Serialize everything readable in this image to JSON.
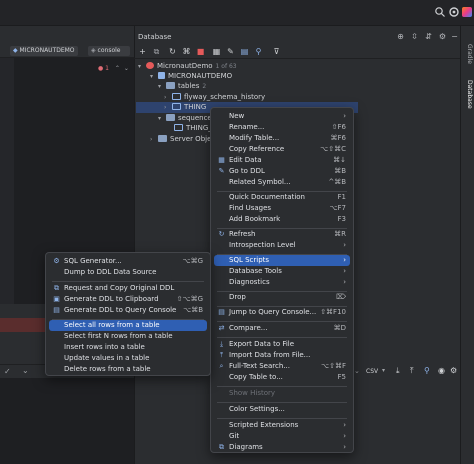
{
  "colors": {
    "accent": "#2f5fb3",
    "selection_row": "#2e436e",
    "error_row": "#5a2d2d",
    "icon_blue": "#8fb3e8",
    "icon_green": "#5fb865",
    "icon_red": "#e55a5a"
  },
  "left_toolbar": {
    "datasource": "MICRONAUTDEMO",
    "console": "console"
  },
  "left_editor": {
    "warning_count": "1"
  },
  "db_panel": {
    "title": "Database"
  },
  "tree": {
    "root": "MicronautDemo",
    "root_badge": "1 of 63",
    "schema": "MICRONAUTDEMO",
    "tables_label": "tables",
    "tables_count": "2",
    "table1": "flyway_schema_history",
    "table2": "THING",
    "sequences": "sequences",
    "sequence_item": "THING_",
    "server_objects": "Server Objects"
  },
  "results_toolbar": {
    "format": "CSV"
  },
  "side_tabs": {
    "gradle": "Gradle",
    "database": "Database"
  },
  "main_menu": {
    "items": [
      {
        "label": "New",
        "shortcut": "",
        "submenu": true
      },
      {
        "label": "Rename...",
        "shortcut": "⇧F6"
      },
      {
        "label": "Modify Table...",
        "shortcut": "⌘F6"
      },
      {
        "label": "Copy Reference",
        "shortcut": "⌥⇧⌘C"
      },
      {
        "label": "Edit Data",
        "shortcut": "⌘↓"
      },
      {
        "label": "Go to DDL",
        "shortcut": "⌘B"
      },
      {
        "label": "Related Symbol...",
        "shortcut": "^⌘B"
      },
      {
        "label": "Quick Documentation",
        "shortcut": "F1"
      },
      {
        "label": "Find Usages",
        "shortcut": "⌥F7"
      },
      {
        "label": "Add Bookmark",
        "shortcut": "F3"
      },
      {
        "label": "Refresh",
        "shortcut": "⌘R"
      },
      {
        "label": "Introspection Level",
        "submenu": true
      },
      {
        "label": "SQL Scripts",
        "submenu": true
      },
      {
        "label": "Database Tools",
        "submenu": true
      },
      {
        "label": "Diagnostics",
        "submenu": true
      },
      {
        "label": "Drop",
        "shortcut": "⌦"
      },
      {
        "label": "Jump to Query Console...",
        "shortcut": "⇧⌘F10"
      },
      {
        "label": "Compare...",
        "shortcut": "⌘D"
      },
      {
        "label": "Export Data to File"
      },
      {
        "label": "Import Data from File..."
      },
      {
        "label": "Full-Text Search...",
        "shortcut": "⌥⇧⌘F"
      },
      {
        "label": "Copy Table to...",
        "shortcut": "F5"
      },
      {
        "label": "Show History"
      },
      {
        "label": "Color Settings..."
      },
      {
        "label": "Scripted Extensions",
        "submenu": true
      },
      {
        "label": "Git",
        "submenu": true
      },
      {
        "label": "Diagrams",
        "submenu": true
      }
    ]
  },
  "sub_menu": {
    "items": [
      {
        "label": "SQL Generator...",
        "shortcut": "⌥⌘G"
      },
      {
        "label": "Dump to DDL Data Source"
      },
      {
        "label": "Request and Copy Original DDL"
      },
      {
        "label": "Generate DDL to Clipboard",
        "shortcut": "⇧⌥⌘G"
      },
      {
        "label": "Generate DDL to Query Console",
        "shortcut": "⌥⌘B"
      },
      {
        "label": "Select all rows from a table"
      },
      {
        "label": "Select first N rows from a table"
      },
      {
        "label": "Insert rows into a table"
      },
      {
        "label": "Update values in a table"
      },
      {
        "label": "Delete rows from a table"
      }
    ]
  }
}
